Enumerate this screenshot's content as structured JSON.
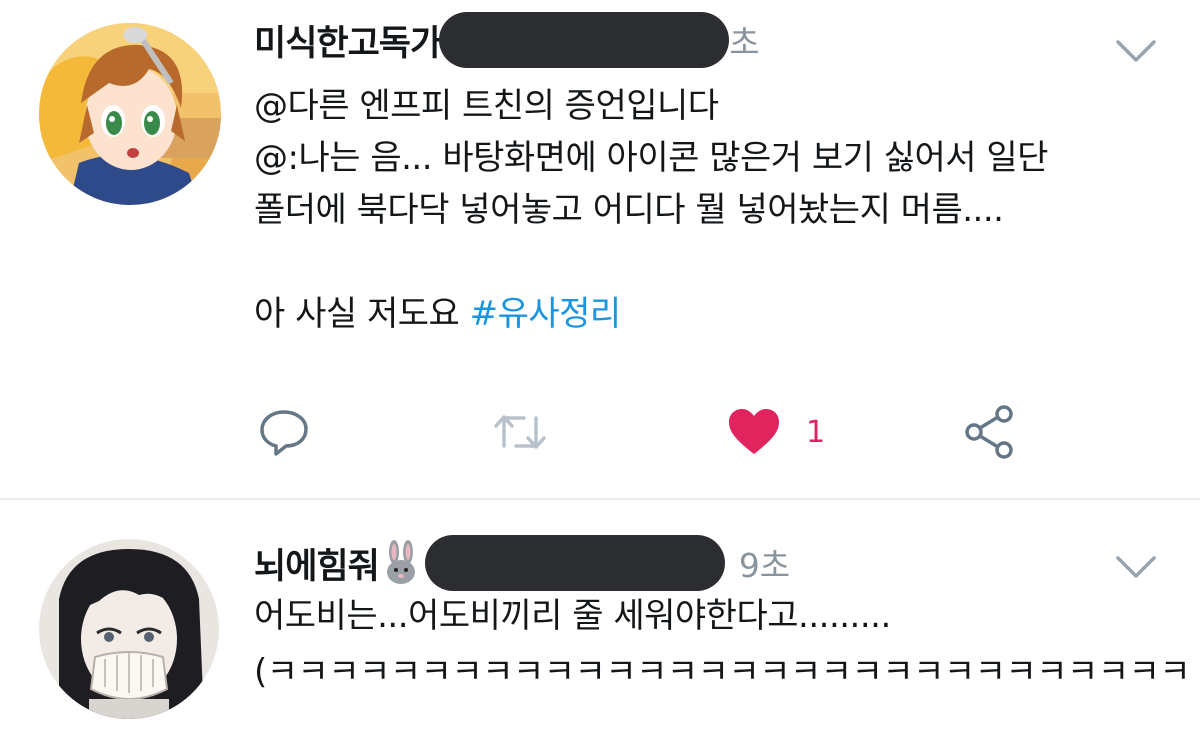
{
  "tweets": [
    {
      "display_name": "미식한고독가",
      "time": "초",
      "lines": [
        "@다른 엔프피 트친의 증언입니다",
        "@:나는 음... 바탕화면에 아이콘 많은거 보기 싫어서 일단",
        "폴더에 북다닥 넣어놓고 어디다 뭘 넣어놨는지 머름...."
      ],
      "last_line_text": "아 사실 저도요 ",
      "hashtag": "#유사정리",
      "like_count": "1",
      "avatar_icon": "anime-girl-avatar"
    },
    {
      "display_name": "뇌에힘줘",
      "emoji": "rabbit-emoji",
      "time": "9초",
      "lines": [
        "어도비는...어도비끼리 줄 세워야한다고.........",
        "(ㅋㅋㅋㅋㅋㅋㅋㅋㅋㅋㅋㅋㅋㅋㅋㅋㅋㅋㅋㅋㅋㅋㅋㅋㅋㅋㅋㅋㅋㅋ"
      ],
      "avatar_icon": "manga-character-avatar"
    }
  ],
  "colors": {
    "text": "#14171a",
    "muted": "#8a949e",
    "hashtag": "#1b95e0",
    "like": "#e0245e",
    "icon": "#657786",
    "divider": "#e6ecf0",
    "redaction": "#2b2d30"
  }
}
